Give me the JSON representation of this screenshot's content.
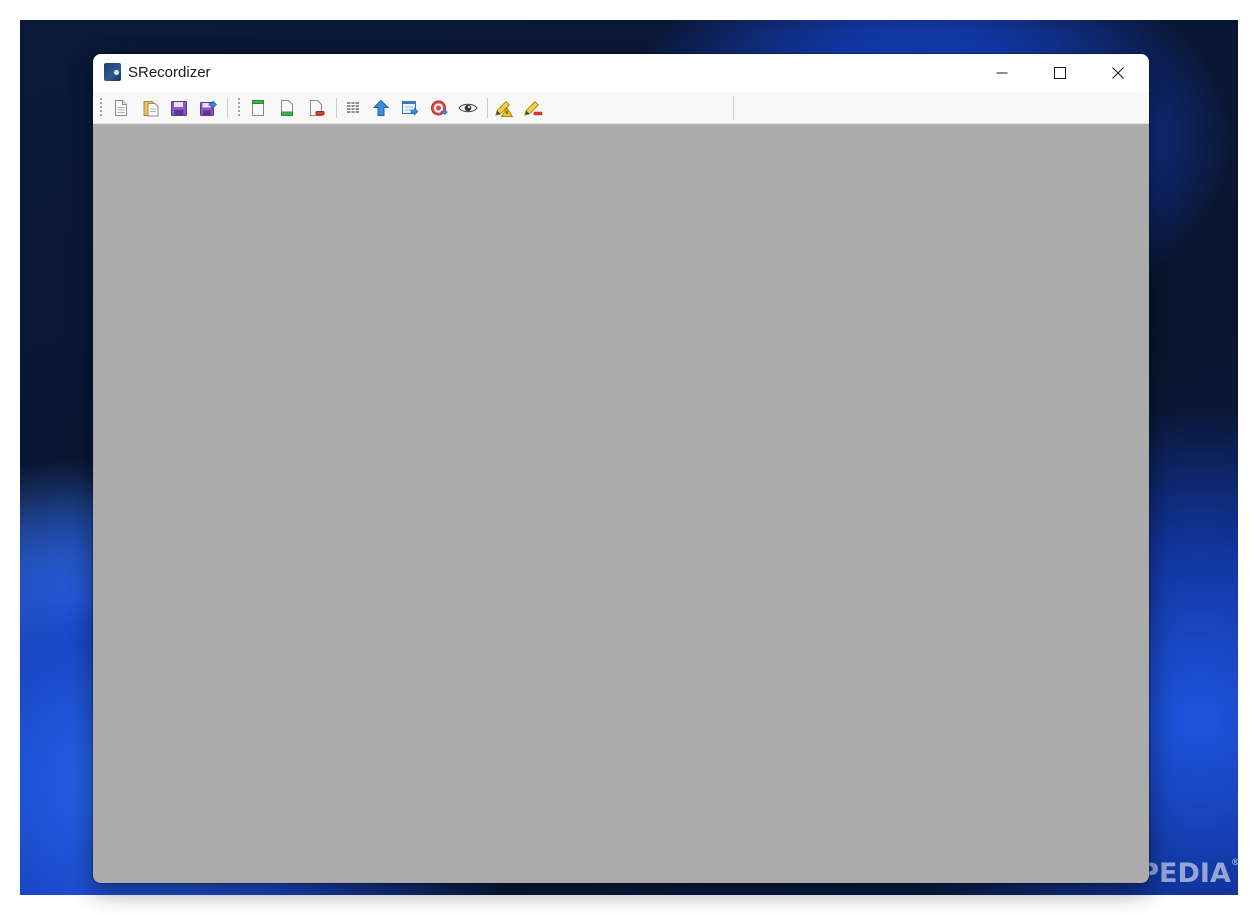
{
  "window": {
    "title": "SRecordizer",
    "controls": {
      "minimize": "minimize",
      "maximize": "maximize",
      "close": "close"
    }
  },
  "toolbar": {
    "buttons": [
      {
        "name": "new-document",
        "icon": "new-document-icon"
      },
      {
        "name": "open-document",
        "icon": "open-document-icon"
      },
      {
        "name": "save",
        "icon": "save-icon"
      },
      {
        "name": "save-as",
        "icon": "save-as-icon"
      },
      {
        "name": "new-record",
        "icon": "document-green-icon"
      },
      {
        "name": "insert-record",
        "icon": "document-insert-icon"
      },
      {
        "name": "delete-record",
        "icon": "document-delete-icon"
      },
      {
        "name": "list-view",
        "icon": "list-icon"
      },
      {
        "name": "move-up",
        "icon": "arrow-up-icon"
      },
      {
        "name": "export",
        "icon": "export-icon"
      },
      {
        "name": "target",
        "icon": "target-icon"
      },
      {
        "name": "view",
        "icon": "eye-icon"
      },
      {
        "name": "edit-warning",
        "icon": "pencil-warning-icon"
      },
      {
        "name": "edit-remove",
        "icon": "pencil-remove-icon"
      }
    ]
  },
  "watermark": {
    "text": "SOFTPEDIA",
    "mark": "®"
  },
  "colors": {
    "client_area": "#ababab",
    "titlebar": "#ffffff",
    "toolbar": "#f8f8f8"
  }
}
